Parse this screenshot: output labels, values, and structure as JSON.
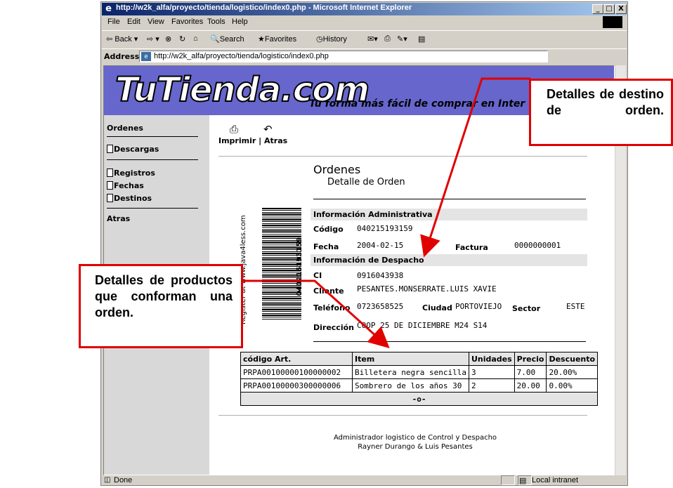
{
  "window": {
    "title": "http://w2k_alfa/proyecto/tienda/logistico/index0.php - Microsoft Internet Explorer",
    "controls": [
      "_",
      "□",
      "X"
    ]
  },
  "menu": [
    "File",
    "Edit",
    "View",
    "Favorites",
    "Tools",
    "Help"
  ],
  "toolbar": {
    "back": "⇦ Back ▾",
    "forward": "⇨ ▾",
    "stop": "⊗",
    "refresh": "↻",
    "home": "⌂",
    "search": "Search",
    "favorites": "Favorites",
    "history": "History"
  },
  "address": {
    "label": "Address",
    "url": "http://w2k_alfa/proyecto/tienda/logistico/index0.php"
  },
  "banner": {
    "logo": "TuTienda.com",
    "tagline": "Tu forma más fácil de comprar en Inter"
  },
  "sidebar": {
    "ordenes": "Ordenes",
    "descargas": "Descargas",
    "registros": "Registros",
    "fechas": "Fechas",
    "destinos": "Destinos",
    "atras": "Atras"
  },
  "actions": {
    "imprimir": "Imprimir",
    "separator": "|",
    "atras": "Atras"
  },
  "heading": {
    "title": "Ordenes",
    "subtitle": "Detalle de Orden"
  },
  "barcode": {
    "side_text": "Register at www.java4less.com",
    "number": "040215193159"
  },
  "admin": {
    "section": "Información Administrativa",
    "codigo_label": "Código",
    "codigo": "040215193159",
    "fecha_label": "Fecha",
    "fecha": "2004-02-15",
    "factura_label": "Factura",
    "factura": "0000000001"
  },
  "despacho": {
    "section": "Información de Despacho",
    "ci_label": "CI",
    "ci": "0916043938",
    "cliente_label": "Cliente",
    "cliente": "PESANTES.MONSERRATE.LUIS XAVIE",
    "telefono_label": "Teléfono",
    "telefono": "0723658525",
    "ciudad_label": "Ciudad",
    "ciudad": "PORTOVIEJO",
    "sector_label": "Sector",
    "sector": "ESTE",
    "direccion_label": "Dirección",
    "direccion": "COOP 25 DE DICIEMBRE M24 S14"
  },
  "items_table": {
    "headers": [
      "código Art.",
      "Item",
      "Unidades",
      "Precio",
      "Descuento"
    ],
    "rows": [
      [
        "PRPA00100000100000002",
        "Billetera negra sencilla",
        "3",
        "7.00",
        "20.00%"
      ],
      [
        "PRPA00100000300000006",
        "Sombrero de los años 30",
        "2",
        "20.00",
        "0.00%"
      ]
    ],
    "footer": "-o-"
  },
  "footer": {
    "line1": "Administrador logistico de Control y Despacho",
    "line2": "Rayner Durango & Luis Pesantes"
  },
  "status": {
    "left": "Done",
    "zone": "Local intranet"
  },
  "callouts": {
    "destino": "Detalles de destino de orden.",
    "productos": "Detalles de productos que conforman una orden."
  },
  "colors": {
    "banner": "#6666cc",
    "sidebar": "#d8d8d8",
    "callout_border": "#e00000",
    "arrow": "#e00000"
  }
}
